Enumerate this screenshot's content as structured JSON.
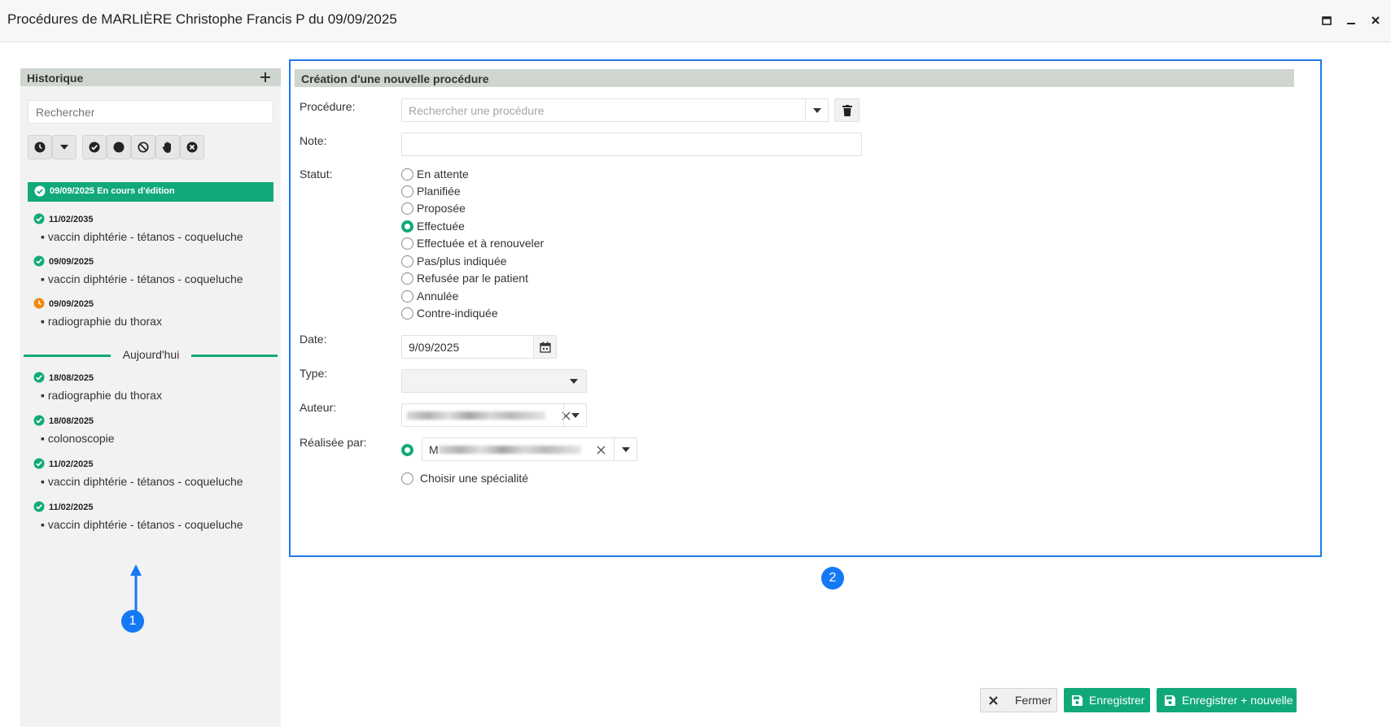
{
  "window": {
    "title": "Procédures de MARLIÈRE Christophe Francis P du 09/09/2025",
    "controls": [
      "maximize-icon",
      "minimize-icon",
      "close-icon"
    ]
  },
  "history": {
    "header": "Historique",
    "add_icon": "plus-icon",
    "search_placeholder": "Rechercher",
    "filters": [
      "clock-icon",
      "chevron-down-icon",
      "check-circle-icon",
      "dot-circle-icon",
      "ban-icon",
      "hand-icon",
      "times-circle-icon"
    ],
    "active_item": "09/09/2025 En cours d'édition",
    "items_before": [
      {
        "date": "11/02/2035",
        "text": "▪ vaccin diphtérie - tétanos - coqueluche",
        "status": "done"
      },
      {
        "date": "09/09/2025",
        "text": "▪ vaccin diphtérie - tétanos - coqueluche",
        "status": "done"
      },
      {
        "date": "09/09/2025",
        "text": "▪ radiographie du thorax",
        "status": "pending"
      }
    ],
    "today_label": "Aujourd'hui",
    "items_after": [
      {
        "date": "18/08/2025",
        "text": "▪ radiographie du thorax",
        "status": "done"
      },
      {
        "date": "18/08/2025",
        "text": "▪ colonoscopie",
        "status": "done"
      },
      {
        "date": "11/02/2025",
        "text": "▪ vaccin diphtérie - tétanos - coqueluche",
        "status": "done"
      },
      {
        "date": "11/02/2025",
        "text": "▪ vaccin diphtérie - tétanos - coqueluche",
        "status": "done"
      }
    ]
  },
  "form": {
    "header": "Création d'une nouvelle procédure",
    "procedure_label": "Procédure:",
    "procedure_placeholder": "Rechercher une procédure",
    "note_label": "Note:",
    "note_value": "",
    "status_label": "Statut:",
    "status_options": [
      "En attente",
      "Planifiée",
      "Proposée",
      "Effectuée",
      "Effectuée et à renouveler",
      "Pas/plus indiquée",
      "Refusée par le patient",
      "Annulée",
      "Contre-indiquée"
    ],
    "status_selected": "Effectuée",
    "date_label": "Date:",
    "date_value": "9/09/2025",
    "type_label": "Type:",
    "type_value": "",
    "author_label": "Auteur:",
    "performed_label": "Réalisée par:",
    "performed_prefix": "M",
    "specialty_label": "Choisir une spécialité"
  },
  "annotations": [
    "1",
    "2"
  ],
  "buttons": {
    "close": "Fermer",
    "save": "Enregistrer",
    "save_new": "Enregistrer + nouvelle"
  },
  "colors": {
    "accent": "#12a97a",
    "pending": "#f08a12",
    "annotation": "#1479f5",
    "header_bg": "#cfd5cf"
  }
}
